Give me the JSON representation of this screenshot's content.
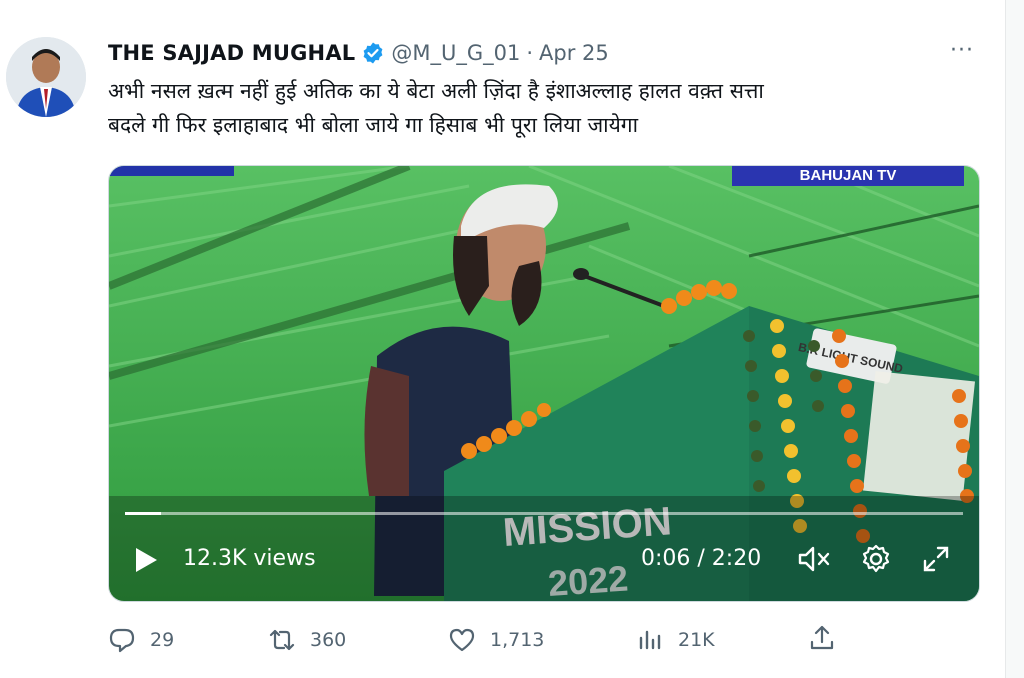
{
  "tweet": {
    "display_name": "THE SAJJAD MUGHAL",
    "handle": "@M_U_G_01",
    "separator": "·",
    "date": "Apr 25",
    "more_label": "···",
    "text_lines": [
      "अभी नसल ख़त्म नहीं हुई अतिक का ये बेटा अली ज़िंदा है इंशाअल्लाह हालत वक़्त सत्ता",
      "बदले गी फिर इलाहाबाद भी बोला जाये गा हिसाब भी पूरा लिया जायेगा"
    ]
  },
  "video": {
    "views": "12.3K views",
    "time": "0:06 / 2:20",
    "progress_fraction": 0.043,
    "overlay_text": {
      "banner_top_right": "BAHUJAN TV",
      "sign": "B.K LIGHT SOUND",
      "podium": "MISSION",
      "podium_year": "2022"
    }
  },
  "actions": {
    "replies": "29",
    "reposts": "360",
    "likes": "1,713",
    "views": "21K"
  },
  "colors": {
    "verified": "#1d9bf0",
    "secondary_text": "#536471",
    "tent_green": "#3da84a",
    "podium_green": "#1f8a5a"
  },
  "icons": [
    "verified-badge-icon",
    "more-icon",
    "play-icon",
    "mute-icon",
    "settings-icon",
    "fullscreen-icon",
    "reply-icon",
    "repost-icon",
    "like-icon",
    "analytics-icon",
    "share-icon"
  ]
}
